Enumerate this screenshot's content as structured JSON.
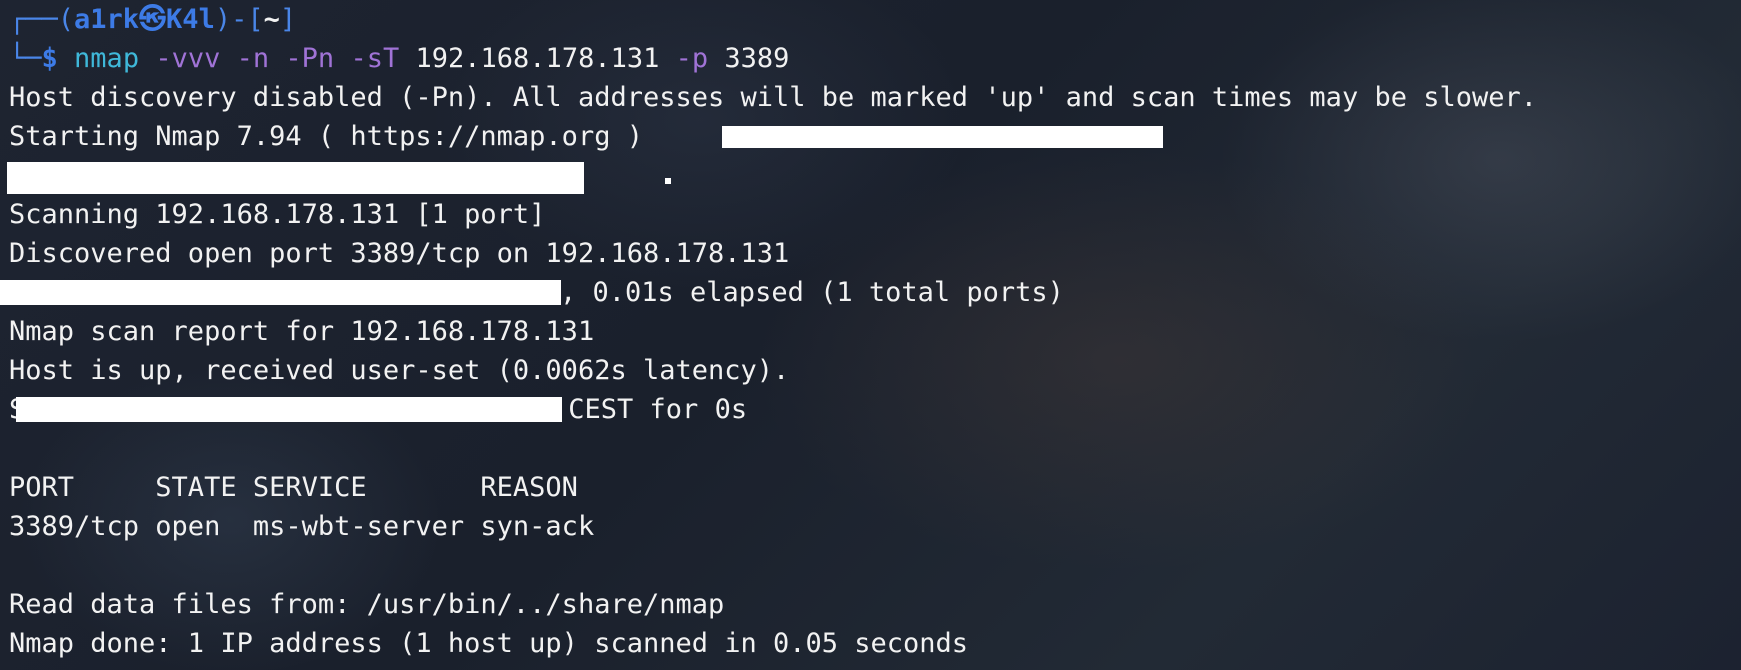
{
  "prompt": {
    "line1_prefix": "┌──(",
    "user": "a1rk㉿K4l",
    "line1_mid": ")-[",
    "cwd": "~",
    "line1_suffix": "]",
    "line2_prefix": "└─",
    "symbol": "$"
  },
  "command": {
    "program": "nmap",
    "flag_vvv": "-vvv",
    "flag_n": "-n",
    "flag_pn": "-Pn",
    "flag_st": "-sT",
    "target": "192.168.178.131",
    "flag_p": "-p",
    "port": "3389"
  },
  "output": {
    "host_discovery": "Host discovery disabled (-Pn). All addresses will be marked 'up' and scan times may be slower.",
    "starting": "Starting Nmap 7.94 ( https://nmap.org )",
    "scanning": "Scanning 192.168.178.131 [1 port]",
    "discovered": "Discovered open port 3389/tcp on 192.168.178.131",
    "elapsed": ", 0.01s elapsed (1 total ports)",
    "report": "Nmap scan report for 192.168.178.131",
    "host_up": "Host is up, received user-set (0.0062s latency).",
    "scanned_prefix": "S",
    "scanned_suffix": "CEST for 0s",
    "table_header": "PORT     STATE SERVICE       REASON",
    "table_row": "3389/tcp open  ms-wbt-server syn-ack",
    "read_data": "Read data files from: /usr/bin/../share/nmap",
    "done": "Nmap done: 1 IP address (1 host up) scanned in 0.05 seconds"
  },
  "colors": {
    "background": "#1c2230",
    "text": "#f2f2f2",
    "prompt_blue": "#3d7be6",
    "command_cyan": "#3fb8d9",
    "flag_purple": "#a073d6",
    "redaction": "#ffffff"
  }
}
